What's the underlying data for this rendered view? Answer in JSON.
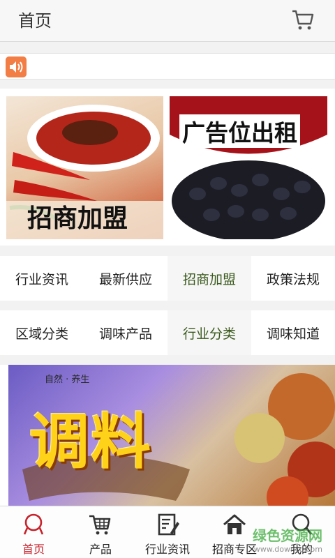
{
  "header": {
    "title": "首页",
    "cart_icon": "cart-icon"
  },
  "notice": {
    "icon": "speaker-icon",
    "text": ""
  },
  "banners": [
    {
      "caption": "招商加盟"
    },
    {
      "caption": "广告位出租"
    }
  ],
  "categories": {
    "row1": [
      "行业资讯",
      "最新供应",
      "招商加盟",
      "政策法规"
    ],
    "row2": [
      "区域分类",
      "调味产品",
      "行业分类",
      "调味知道"
    ]
  },
  "promo": {
    "brand": "自然 · 养生",
    "headline": "调料"
  },
  "tabbar": [
    {
      "label": "首页",
      "icon": "home-user-icon",
      "active": true
    },
    {
      "label": "产品",
      "icon": "cart-icon"
    },
    {
      "label": "行业资讯",
      "icon": "news-icon"
    },
    {
      "label": "招商专区",
      "icon": "house-icon"
    },
    {
      "label": "我的",
      "icon": "search-icon"
    }
  ],
  "watermark": {
    "text": "绿色资源网",
    "sub": "www.downcc.com"
  },
  "colors": {
    "accent": "#c8232d",
    "active_category": "#3a5a1c",
    "speaker": "#f27d45"
  }
}
